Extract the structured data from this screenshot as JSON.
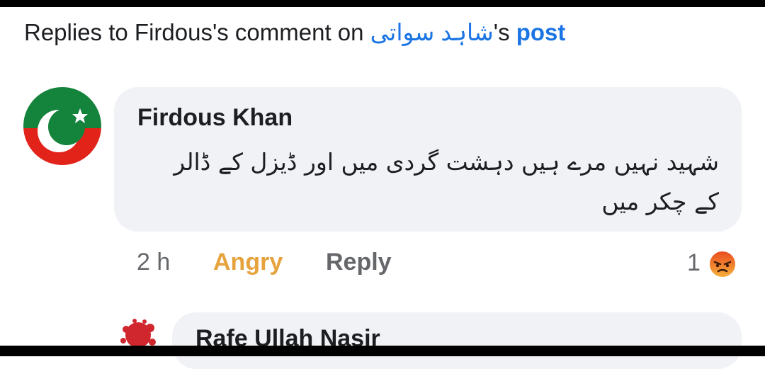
{
  "header": {
    "prefix": "Replies to Firdous's comment on ",
    "page_name": "شاہد سواتی",
    "suffix": "'s ",
    "post_link": "post"
  },
  "comment": {
    "author": "Firdous Khan",
    "text": "شہید نہیں مرے ہیں دہشت گردی میں اور ڈیزل کے ڈالر کے چکر میں",
    "avatar_icon": "pti-flag-avatar",
    "time": "2 h",
    "reaction_label": "Angry",
    "reply_label": "Reply",
    "reaction_count": "1",
    "reaction_icon": "angry-emoji-icon"
  },
  "next_reply": {
    "author": "Rafe Ullah Nasir",
    "avatar_icon": "red-splash-avatar"
  },
  "colors": {
    "link": "#1b74e4",
    "angry": "#e6a33d",
    "bubble": "#f0f2f5",
    "meta": "#65676b"
  }
}
